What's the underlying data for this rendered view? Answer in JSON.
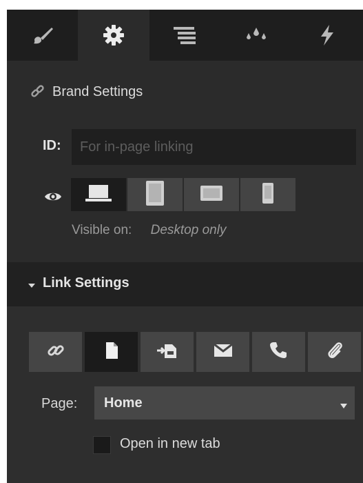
{
  "tabs": [
    {
      "icon": "paintbrush-icon",
      "active": false
    },
    {
      "icon": "gear-icon",
      "active": true
    },
    {
      "icon": "layers-icon",
      "active": false
    },
    {
      "icon": "droplets-icon",
      "active": false
    },
    {
      "icon": "lightning-icon",
      "active": false
    }
  ],
  "brand_settings": {
    "icon": "link-chain-icon",
    "title": "Brand Settings"
  },
  "id_field": {
    "label": "ID:",
    "value": "",
    "placeholder": "For in-page linking"
  },
  "visibility": {
    "icon": "eye-icon",
    "devices": [
      {
        "name": "desktop",
        "active": true
      },
      {
        "name": "tablet-portrait",
        "active": false
      },
      {
        "name": "tablet-landscape",
        "active": false
      },
      {
        "name": "phone",
        "active": false
      }
    ],
    "label": "Visible on:",
    "value": "Desktop only"
  },
  "link_settings": {
    "title": "Link Settings",
    "expanded": true,
    "types": [
      {
        "icon": "link-icon",
        "active": false
      },
      {
        "icon": "page-icon",
        "active": true
      },
      {
        "icon": "page-section-icon",
        "active": false
      },
      {
        "icon": "email-icon",
        "active": false
      },
      {
        "icon": "phone-icon",
        "active": false
      },
      {
        "icon": "paperclip-icon",
        "active": false
      }
    ],
    "page_label": "Page:",
    "page_value": "Home",
    "open_new_tab_label": "Open in new tab",
    "open_new_tab_checked": false
  },
  "colors": {
    "panel": "#2b2b2b",
    "tab_bar": "#1e1e1e",
    "input": "#1f1f1f",
    "button": "#454545",
    "button_active": "#1b1b1b"
  }
}
